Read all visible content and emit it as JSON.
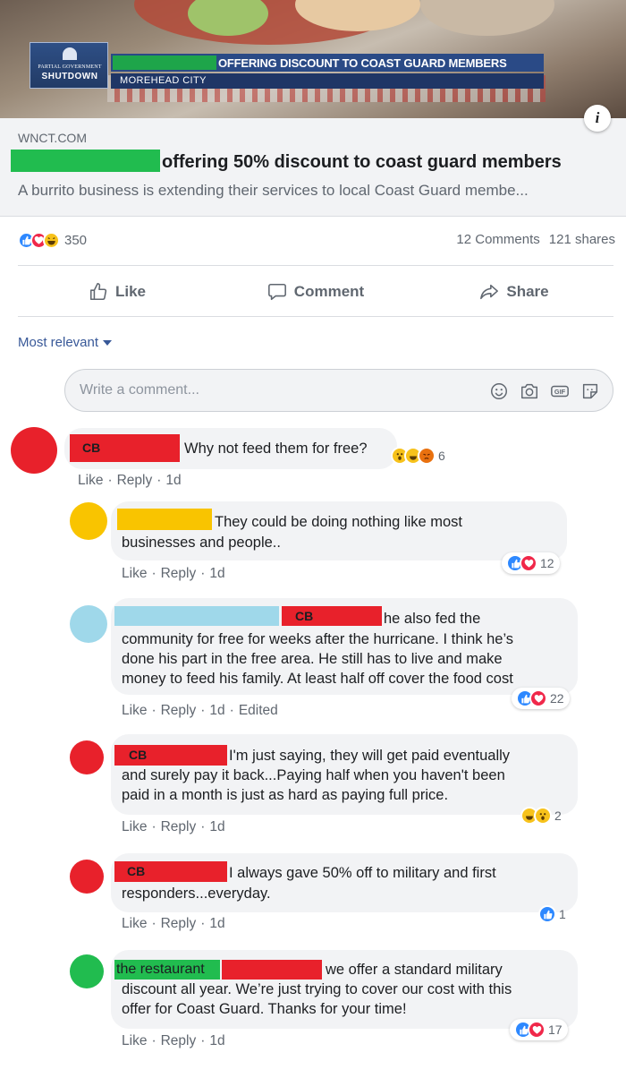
{
  "preview": {
    "logo_line1": "PARTIAL GOVERNMENT",
    "logo_line2": "SHUTDOWN",
    "ticker": "OFFERING DISCOUNT TO COAST GUARD MEMBERS",
    "location": "MOREHEAD CITY",
    "domain": "WNCT.COM",
    "title": "offering 50% discount to coast guard members",
    "description": "A burrito business is extending their services to local Coast Guard membe..."
  },
  "reactions": {
    "count": "350",
    "comments": "12 Comments",
    "shares": "121 shares"
  },
  "actions": {
    "like": "Like",
    "comment": "Comment",
    "share": "Share"
  },
  "sort": {
    "label": "Most relevant"
  },
  "comment_input": {
    "placeholder": "Write a comment..."
  },
  "meta_labels": {
    "like": "Like",
    "reply": "Reply"
  },
  "comments": [
    {
      "author_tag": "CB",
      "text": "Why not feed them for free?",
      "time": "1d",
      "reaction_count": "6"
    },
    {
      "text_line1": "They could be doing nothing like most",
      "text_line2": "businesses and people..",
      "time": "1d",
      "reaction_count": "12"
    },
    {
      "mention": "CB",
      "text_line1": "he also fed the",
      "text_line2": "community for free for weeks after the hurricane. I think he’s",
      "text_line3": "done his part in the free area. He still has to live and make",
      "text_line4": "money to feed his family. At least half off cover the food cost",
      "time": "1d",
      "edited": "Edited",
      "reaction_count": "22"
    },
    {
      "author_tag": "CB",
      "text_line1": "I'm just saying, they will get paid eventually",
      "text_line2": "and surely pay it back...Paying half when you haven't been",
      "text_line3": "paid in a month is just as hard as paying full price.",
      "time": "1d",
      "reaction_count": "2"
    },
    {
      "author_tag": "CB",
      "text_line1": "I always gave 50% off to military and first",
      "text_line2": "responders...everyday.",
      "time": "1d",
      "reaction_count": "1"
    },
    {
      "author_tag": "the restaurant",
      "text_line1": "we offer a standard military",
      "text_line2": "discount all year. We’re just trying to cover our cost with this",
      "text_line3": "offer for Coast Guard. Thanks for your time!",
      "time": "1d",
      "reaction_count": "17"
    }
  ],
  "colors": {
    "redact_red": "#e8212b",
    "redact_green": "#21bc4f",
    "redact_yellow": "#f9c400",
    "redact_blue": "#9fd8ea",
    "fb_blue": "#385898",
    "like_blue": "#2d88ff",
    "love_red": "#f0284a"
  }
}
